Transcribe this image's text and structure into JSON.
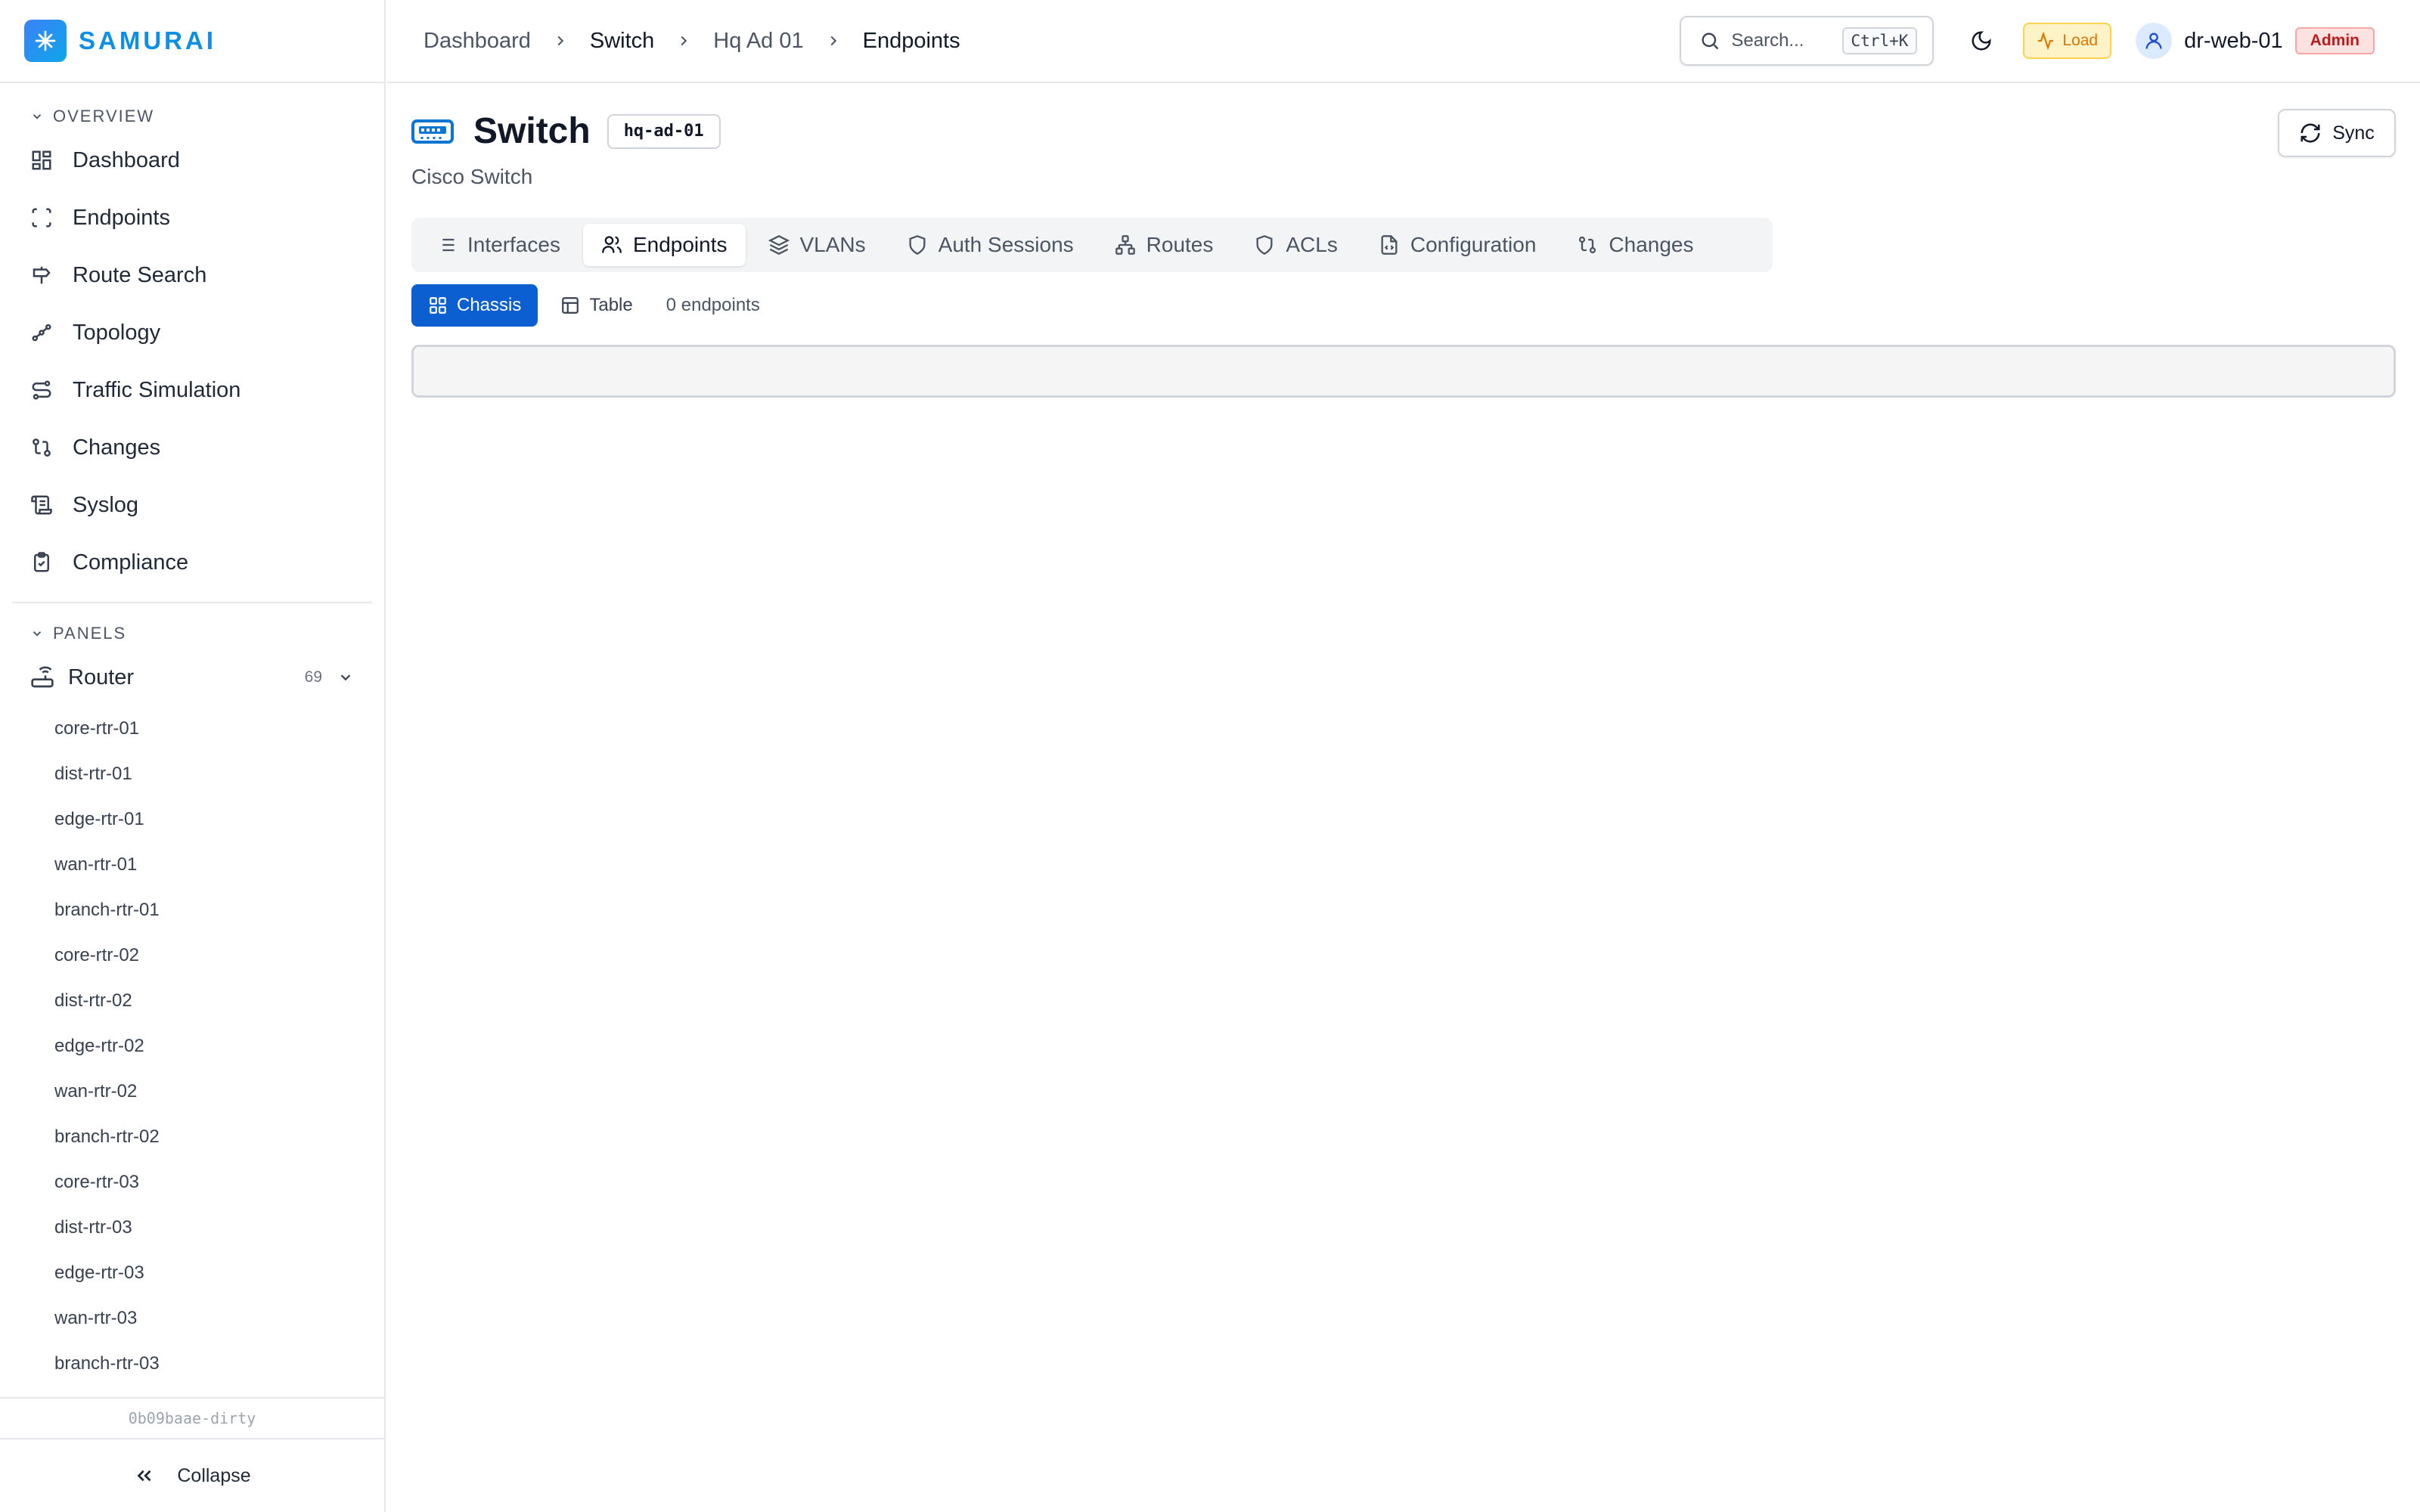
{
  "app": {
    "name": "SAMURAI"
  },
  "sidebar": {
    "overview_label": "OVERVIEW",
    "items": [
      {
        "label": "Dashboard",
        "icon": "grid-icon"
      },
      {
        "label": "Endpoints",
        "icon": "scan-icon"
      },
      {
        "label": "Route Search",
        "icon": "signpost-icon"
      },
      {
        "label": "Topology",
        "icon": "topology-icon"
      },
      {
        "label": "Traffic Simulation",
        "icon": "route-icon"
      },
      {
        "label": "Changes",
        "icon": "git-compare-icon"
      },
      {
        "label": "Syslog",
        "icon": "scroll-icon"
      },
      {
        "label": "Compliance",
        "icon": "clipboard-check-icon"
      }
    ],
    "panels_label": "PANELS",
    "router": {
      "label": "Router",
      "count": "69"
    },
    "routers": [
      "core-rtr-01",
      "dist-rtr-01",
      "edge-rtr-01",
      "wan-rtr-01",
      "branch-rtr-01",
      "core-rtr-02",
      "dist-rtr-02",
      "edge-rtr-02",
      "wan-rtr-02",
      "branch-rtr-02",
      "core-rtr-03",
      "dist-rtr-03",
      "edge-rtr-03",
      "wan-rtr-03",
      "branch-rtr-03"
    ],
    "build_hash": "0b09baae-dirty",
    "collapse_label": "Collapse"
  },
  "topbar": {
    "breadcrumbs": [
      "Dashboard",
      "Switch",
      "Hq Ad 01",
      "Endpoints"
    ],
    "search_placeholder": "Search...",
    "search_shortcut": "Ctrl+K",
    "load_label": "Load",
    "user_name": "dr-web-01",
    "user_role": "Admin"
  },
  "page": {
    "title": "Switch",
    "hostname": "hq-ad-01",
    "subtitle": "Cisco Switch",
    "sync_label": "Sync",
    "tabs": [
      "Interfaces",
      "Endpoints",
      "VLANs",
      "Auth Sessions",
      "Routes",
      "ACLs",
      "Configuration",
      "Changes"
    ],
    "active_tab": "Endpoints",
    "views": [
      "Chassis",
      "Table"
    ],
    "active_view": "Chassis",
    "endpoint_count": "0 endpoints"
  },
  "colors": {
    "accent": "#0b5fd1",
    "brand": "#0d8fe6"
  }
}
